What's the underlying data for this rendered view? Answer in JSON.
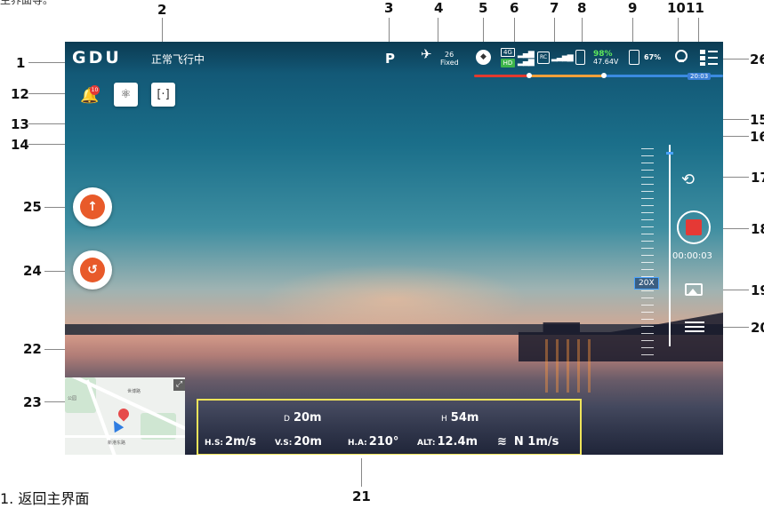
{
  "top_hint": "主界面等。",
  "app": {
    "logo": "GDU",
    "flight_status": "正常飞行中",
    "mode": "P",
    "satellites": {
      "count": "26",
      "status": "Fixed"
    },
    "network": {
      "tag1": "4G",
      "tag2": "HD"
    },
    "rc_tag": "RC",
    "aircraft_battery": {
      "percent": "98%",
      "voltage": "47.64V"
    },
    "rc_battery": {
      "percent": "67%"
    },
    "time_remaining": "20:03",
    "notification_count": "10",
    "zoom": "20X",
    "record_time": "00:00:03"
  },
  "telemetry": {
    "d_label": "D",
    "d_value": "20m",
    "h_label": "H",
    "h_value": "54m",
    "hs_label": "H.S:",
    "hs_value": "2m/s",
    "vs_label": "V.S:",
    "vs_value": "20m",
    "ha_label": "H.A:",
    "ha_value": "210°",
    "alt_label": "ALT:",
    "alt_value": "12.4m",
    "wind_value": "N 1m/s"
  },
  "map": {
    "labels": [
      "公园",
      "世博路",
      "新港东路"
    ]
  },
  "callouts": {
    "n1": "1",
    "n2": "2",
    "n3": "3",
    "n4": "4",
    "n5": "5",
    "n6": "6",
    "n7": "7",
    "n8": "8",
    "n9": "9",
    "n10": "10",
    "n11": "11",
    "n12": "12",
    "n13": "13",
    "n14": "14",
    "n15": "15",
    "n16": "16",
    "n17": "17",
    "n18": "18",
    "n19": "19",
    "n20": "20",
    "n21": "21",
    "n22": "22",
    "n23": "23",
    "n24": "24",
    "n25": "25",
    "n26": "26"
  },
  "footer": "1.   返回主界面",
  "icons": {
    "satellite": "satellite-icon",
    "compass": "compass-icon",
    "bell": "bell-icon",
    "obstacle": "obstacle-avoidance-icon",
    "focus": "focus-icon",
    "return_home": "return-home-icon",
    "takeoff": "takeoff-icon",
    "camera_switch": "camera-switch-icon",
    "gallery": "gallery-icon",
    "settings": "camera-settings-icon",
    "expand": "expand-icon"
  },
  "colors": {
    "accent": "#3a8be0",
    "record": "#e53935",
    "rth": "#e85a2a",
    "telemetry_border": "#f0e45a"
  }
}
